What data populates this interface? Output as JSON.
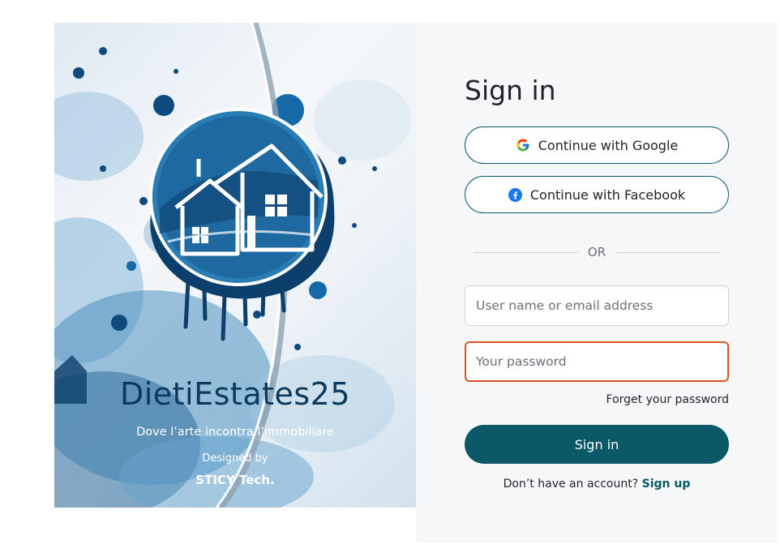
{
  "hero": {
    "logo": "house-splash-logo",
    "title": "DietiEstates25",
    "tagline": "Dove l’arte incontra l’immobiliare",
    "designed_by": "Designed by",
    "company": "STICY Tech."
  },
  "form": {
    "title": "Sign in",
    "google_label": "Continue with Google",
    "facebook_label": "Continue with Facebook",
    "divider_text": "OR",
    "username_placeholder": "User name or email address",
    "username_value": "",
    "password_placeholder": "Your password",
    "password_value": "",
    "forget_label": "Forget your password",
    "submit_label": "Sign in",
    "signup_prompt": "Don’t have an account?",
    "signup_link": "Sign up"
  },
  "colors": {
    "accent": "#0b5866",
    "focus_border": "#d9541e",
    "panel_bg": "#f6f7f9",
    "hero_text": "#0b3a5c"
  },
  "icons": {
    "google": "google-g-icon",
    "facebook": "facebook-f-icon"
  }
}
